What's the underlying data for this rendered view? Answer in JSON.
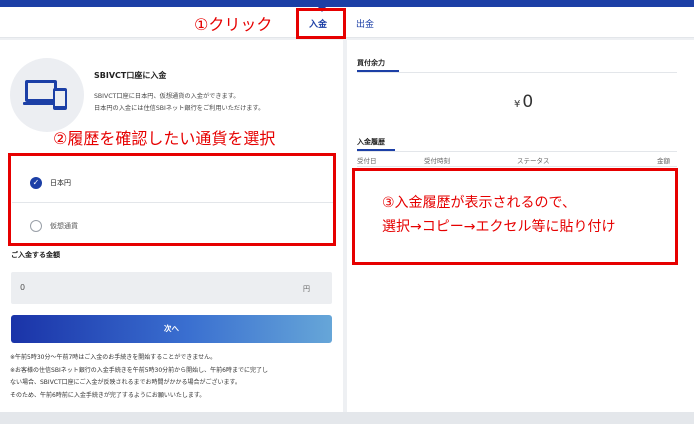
{
  "tabs": {
    "deposit": "入金",
    "withdraw": "出金"
  },
  "account": {
    "title": "SBIVCT口座に入金",
    "desc_line1": "SBIVCT口座に日本円、仮想通貨の入金ができます。",
    "desc_line2": "日本円の入金には住信SBIネット銀行をご利用いただけます。"
  },
  "options": [
    {
      "label": "日本円",
      "selected": true
    },
    {
      "label": "仮想通貨",
      "selected": false
    }
  ],
  "amount": {
    "label": "ご入金する金額",
    "value": "0",
    "unit": "円"
  },
  "next_button": "次へ",
  "notes": [
    "※午前5時30分〜午前7時はご入金のお手続きを開始することができません。",
    "※お客様の住信SBIネット銀行の入金手続きを午前5時30分前から開始し、午前6時までに完了し",
    "ない場合、SBIVCT口座にご入金が反映されるまでお時間がかかる場合がございます。",
    "そのため、午前6時前に入金手続きが完了するようにお願いいたします。"
  ],
  "buying_power": {
    "label": "買付余力",
    "currency": "¥",
    "value": "0"
  },
  "history": {
    "label": "入金履歴",
    "columns": [
      "受付日",
      "受付時刻",
      "ステータス",
      "金額"
    ]
  },
  "annotations": {
    "step1": "①クリック",
    "step2": "②履歴を確認したい通貨を選択",
    "step3_line1": "③入金履歴が表示されるので、",
    "step3_line2": "選択→コピー→エクセル等に貼り付け",
    "color": "#e60000"
  },
  "colors": {
    "accent": "#1c3fa6",
    "annotation": "#e60000"
  }
}
